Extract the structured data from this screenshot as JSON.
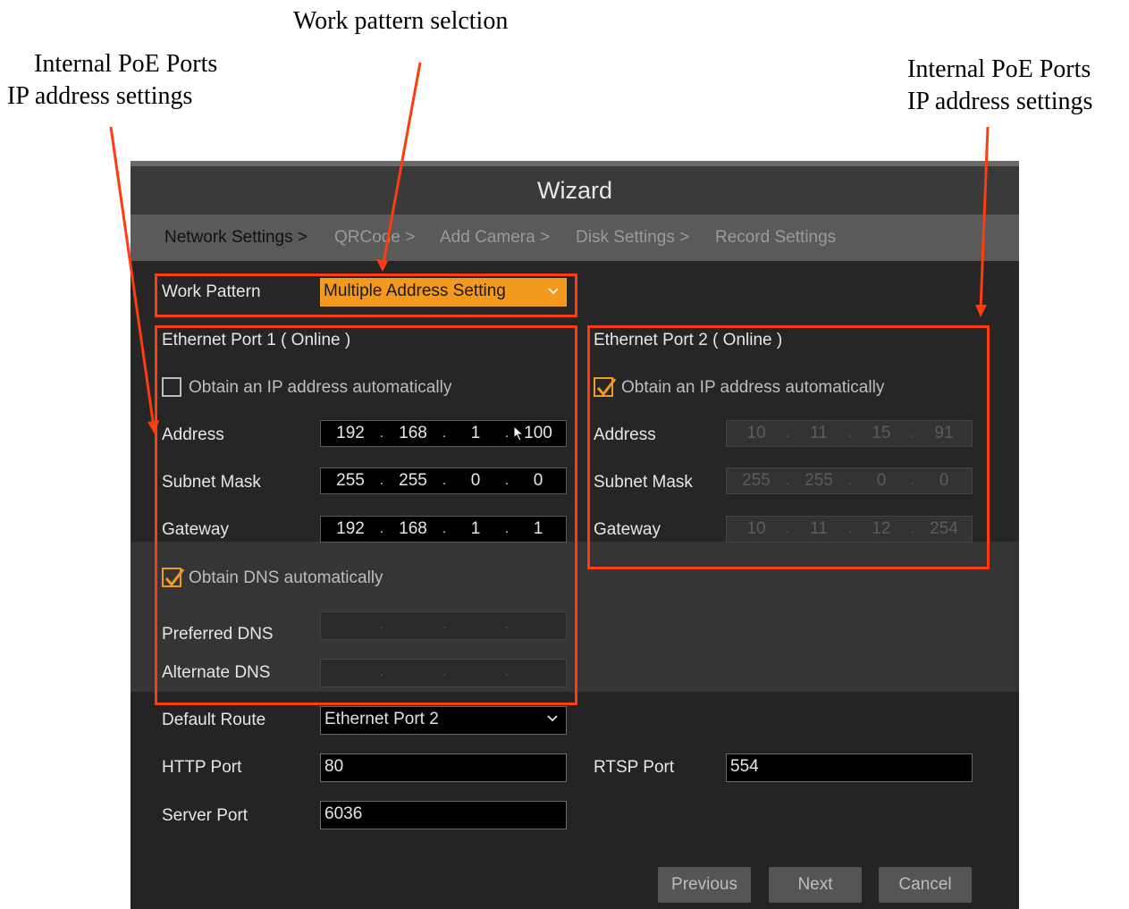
{
  "annotations": {
    "center": "Work pattern selction",
    "left_line1": "Internal PoE Ports",
    "left_line2": "IP address settings",
    "right_line1": "Internal PoE Ports",
    "right_line2": "IP address settings"
  },
  "window": {
    "title": "Wizard"
  },
  "steps": [
    "Network Settings >",
    "QRCode >",
    "Add Camera >",
    "Disk Settings >",
    "Record Settings"
  ],
  "work_pattern": {
    "label": "Work Pattern",
    "value": "Multiple Address Setting"
  },
  "port1": {
    "title": "Ethernet Port 1 ( Online )",
    "obtain_ip_label": "Obtain an IP address automatically",
    "obtain_ip_checked": false,
    "address_label": "Address",
    "address": [
      "192",
      "168",
      "1",
      "100"
    ],
    "subnet_label": "Subnet Mask",
    "subnet": [
      "255",
      "255",
      "0",
      "0"
    ],
    "gateway_label": "Gateway",
    "gateway": [
      "192",
      "168",
      "1",
      "1"
    ],
    "obtain_dns_label": "Obtain DNS automatically",
    "obtain_dns_checked": true,
    "preferred_dns_label": "Preferred DNS",
    "alternate_dns_label": "Alternate DNS"
  },
  "port2": {
    "title": "Ethernet Port 2 ( Online )",
    "obtain_ip_label": "Obtain an IP address automatically",
    "obtain_ip_checked": true,
    "address_label": "Address",
    "address": [
      "10",
      "11",
      "15",
      "91"
    ],
    "subnet_label": "Subnet Mask",
    "subnet": [
      "255",
      "255",
      "0",
      "0"
    ],
    "gateway_label": "Gateway",
    "gateway": [
      "10",
      "11",
      "12",
      "254"
    ]
  },
  "default_route": {
    "label": "Default Route",
    "value": "Ethernet Port 2"
  },
  "http_port": {
    "label": "HTTP Port",
    "value": "80"
  },
  "rtsp_port": {
    "label": "RTSP Port",
    "value": "554"
  },
  "server_port": {
    "label": "Server Port",
    "value": "6036"
  },
  "buttons": {
    "previous": "Previous",
    "next": "Next",
    "cancel": "Cancel"
  },
  "colors": {
    "accent": "#f39a1e",
    "highlight": "#ff3b10"
  }
}
